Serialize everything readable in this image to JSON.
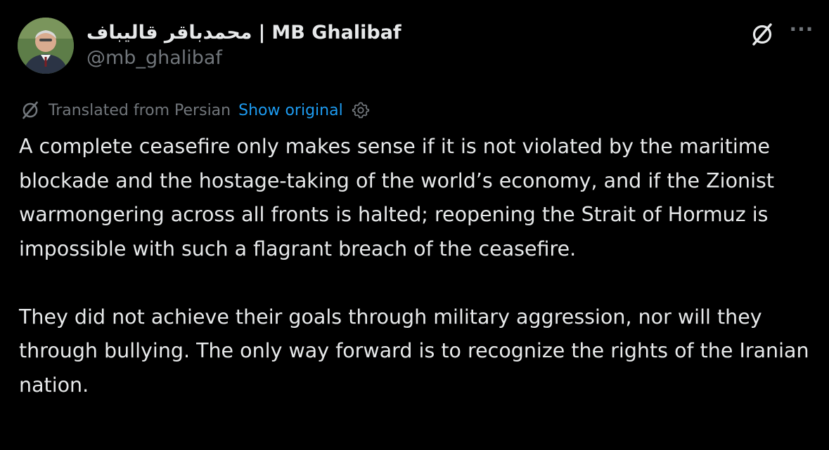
{
  "author": {
    "display_name_persian": "محمدباقر قالیباف",
    "separator": "|",
    "display_name_latin": "MB Ghalibaf",
    "handle": "@mb_ghalibaf"
  },
  "icons": {
    "top_right": "grok-icon",
    "more": "more-icon",
    "translated": "grok-icon",
    "settings": "gear-icon"
  },
  "more_label": "···",
  "translation": {
    "label": "Translated from Persian",
    "link": "Show original"
  },
  "paragraphs": [
    "A complete ceasefire only makes sense if it is not violated by the maritime blockade and the hostage-taking of the world’s economy, and if the Zionist warmongering across all fronts is halted; reopening the Strait of Hormuz is impossible with such a flagrant breach of the ceasefire.",
    "They did not achieve their goals through military aggression, nor will they through bullying. The only way forward is to recognize the rights of the Iranian nation."
  ],
  "colors": {
    "background": "#000000",
    "text": "#e7e9ea",
    "muted": "#71767b",
    "link": "#1d9bf0"
  }
}
